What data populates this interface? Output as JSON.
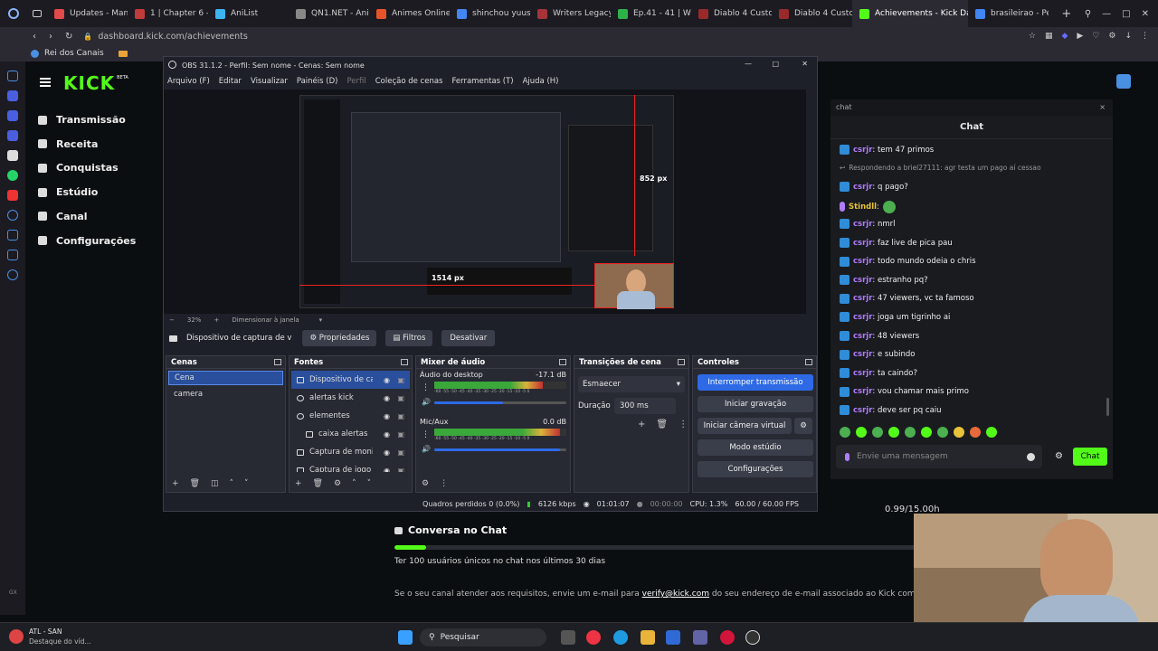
{
  "browser": {
    "tabs": [
      {
        "label": "Updates - Mang",
        "color": "#e34a4a"
      },
      {
        "label": "1 | Chapter 6 -",
        "color": "#c23b3b"
      },
      {
        "label": "AniList",
        "color": "#3db4f2"
      },
      {
        "label": "QN1.NET - Ani",
        "color": "#888888"
      },
      {
        "label": "Animes Online",
        "color": "#e8542a"
      },
      {
        "label": "shinchou yuus",
        "color": "#4285f4"
      },
      {
        "label": "Writers Legacy",
        "color": "#a4343a"
      },
      {
        "label": "Ep.41 - 41 | Wri",
        "color": "#2fb14a"
      },
      {
        "label": "Diablo 4 Custo",
        "color": "#9a2a2a"
      },
      {
        "label": "Diablo 4 Custo",
        "color": "#9a2a2a"
      },
      {
        "label": "Achievements - Kick Das",
        "color": "#53fc18"
      },
      {
        "label": "brasileirao - Pe",
        "color": "#4285f4"
      }
    ],
    "url": "dashboard.kick.com/achievements",
    "bookmark": "Rei dos Canais"
  },
  "kick": {
    "logo": "KICK",
    "logo_sup": "BETA",
    "sidebar": [
      {
        "label": "Transmissão",
        "icon": "broadcast-icon"
      },
      {
        "label": "Receita",
        "icon": "revenue-icon"
      },
      {
        "label": "Conquistas",
        "icon": "trophy-icon"
      },
      {
        "label": "Estúdio",
        "icon": "studio-icon"
      },
      {
        "label": "Canal",
        "icon": "channel-icon"
      },
      {
        "label": "Configurações",
        "icon": "gear-icon"
      }
    ],
    "progress_value": "0.99/15.00h",
    "achievement_title": "Conversa no Chat",
    "achievement_progress": 0.06,
    "achievement_desc": "Ter 100 usuários únicos no chat nos últimos 30 dias",
    "email_text_a": "Se o seu canal atender aos requisitos, envie um e-mail para",
    "email_link": "verify@kick.com",
    "email_text_b": "do seu endereço de e-mail associado ao Kick com"
  },
  "obs": {
    "title": "OBS 31.1.2 - Perfil: Sem nome - Cenas: Sem nome",
    "menu": [
      "Arquivo (F)",
      "Editar",
      "Visualizar",
      "Painéis (D)",
      "Perfil",
      "Coleção de cenas",
      "Ferramentas (T)",
      "Ajuda (H)"
    ],
    "zoom": "32%",
    "resize_label": "Dimensionar à janela",
    "preview_labels": {
      "height": "852 px",
      "width": "1514 px"
    },
    "source_bar": {
      "name": "Dispositivo de captura de v",
      "properties": "Propriedades",
      "filters": "Filtros",
      "deactivate": "Desativar"
    },
    "scenes": {
      "title": "Cenas",
      "items": [
        "Cena",
        "camera"
      ]
    },
    "sources": {
      "title": "Fontes",
      "items": [
        "Dispositivo de cap",
        "alertas kick",
        "elementes",
        "caixa alertas",
        "Captura de moni",
        "Captura de jogo"
      ]
    },
    "mixer": {
      "title": "Mixer de áudio",
      "channels": [
        {
          "name": "Áudio do desktop",
          "db": "-17.1 dB",
          "level": 0.82
        },
        {
          "name": "Mic/Aux",
          "db": "0.0 dB",
          "level": 0.95
        }
      ],
      "scale": "-60 -55 -50 -45 -40 -35 -30 -25 -20 -15 -10 -5 0"
    },
    "transitions": {
      "title": "Transições de cena",
      "selected": "Esmaecer",
      "duration_label": "Duração",
      "duration": "300 ms"
    },
    "controls": {
      "title": "Controles",
      "buttons": [
        "Interromper transmissão",
        "Iniciar gravação",
        "Iniciar câmera virtual",
        "Modo estúdio",
        "Configurações"
      ]
    },
    "status": {
      "dropped": "Quadros perdidos 0 (0.0%)",
      "bitrate": "6126 kbps",
      "live_time": "01:01:07",
      "rec_time": "00:00:00",
      "cpu": "CPU: 1.3%",
      "fps": "60.00 / 60.00 FPS"
    }
  },
  "chat": {
    "popout_label": "chat",
    "title": "Chat",
    "messages": [
      {
        "user": "csrjr",
        "text": ": tem 47 primos"
      },
      {
        "reply": "Respondendo a briel27111: agr testa um pago aí cessao"
      },
      {
        "user": "csrjr",
        "text": ": q pago?"
      },
      {
        "user": "Stindll",
        "text": ":"
      },
      {
        "user": "csrjr",
        "text": ": nmrl"
      },
      {
        "user": "csrjr",
        "text": ": faz live de pica pau"
      },
      {
        "user": "csrjr",
        "text": ": todo mundo odeia o chris"
      },
      {
        "user": "csrjr",
        "text": ": estranho pq?"
      },
      {
        "user": "csrjr",
        "text": ": 47 viewers, vc ta famoso"
      },
      {
        "user": "csrjr",
        "text": ": joga um tigrinho ai"
      },
      {
        "user": "csrjr",
        "text": ": 48 viewers"
      },
      {
        "user": "csrjr",
        "text": ": e subindo"
      },
      {
        "user": "csrjr",
        "text": ": ta caindo?"
      },
      {
        "user": "csrjr",
        "text": ": vou chamar mais primo"
      },
      {
        "user": "csrjr",
        "text": ": deve ser pq caiu"
      }
    ],
    "input_placeholder": "Envie uma mensagem",
    "send_label": "Chat"
  },
  "taskbar": {
    "weather_title": "ATL - SAN",
    "weather_sub": "Destaque do víd...",
    "search": "Pesquisar"
  },
  "colors": {
    "kick_green": "#53fc18",
    "obs_blue": "#2e6ae6",
    "username": "#b07cff"
  }
}
